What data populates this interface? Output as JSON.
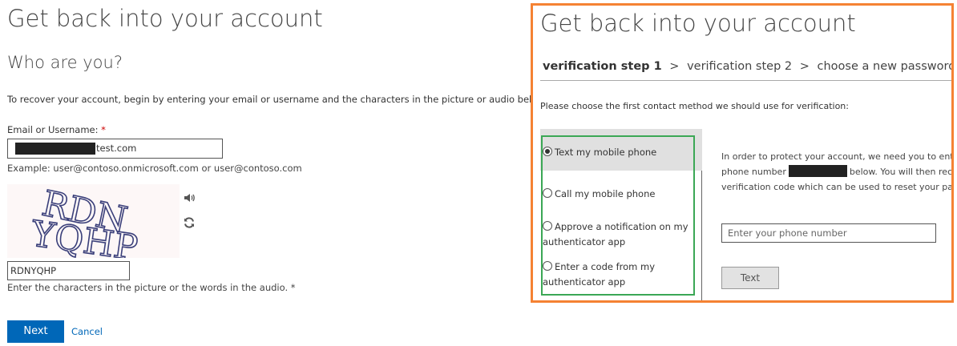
{
  "left": {
    "title": "Get back into your account",
    "subtitle": "Who are you?",
    "intro": "To recover your account, begin by entering your email or username and the characters in the picture or audio below.",
    "email_label": "Email or Username:",
    "required_mark": "*",
    "email_value_visible": "test.com",
    "email_example": "Example: user@contoso.onmicrosoft.com or user@contoso.com",
    "captcha_image_text": "RDNYQHP",
    "captcha_value": "RDNYQHP",
    "captcha_help": "Enter the characters in the picture or the words in the audio. *",
    "next_label": "Next",
    "cancel_label": "Cancel",
    "icons": {
      "audio": "speaker-icon",
      "refresh": "refresh-icon"
    }
  },
  "right": {
    "title": "Get back into your account",
    "steps": {
      "step1": "verification step 1",
      "step2": "verification step 2",
      "step3": "choose a new password",
      "separator": ">"
    },
    "prompt": "Please choose the first contact method we should use for verification:",
    "methods": [
      {
        "lines": [
          "Text my mobile phone"
        ],
        "selected": true
      },
      {
        "lines": [
          "Call my mobile phone"
        ],
        "selected": false
      },
      {
        "lines": [
          "Approve a notification on my",
          "authenticator app"
        ],
        "selected": false
      },
      {
        "lines": [
          "Enter a code from my",
          "authenticator app"
        ],
        "selected": false
      }
    ],
    "info_line1": "In order to protect your account, we need you to ente",
    "info_line2_pre": "phone number",
    "info_line2_post": "below. You will then rec",
    "info_line3": "verification code which can be used to reset your pas",
    "phone_placeholder": "Enter your phone number",
    "text_button_label": "Text"
  },
  "colors": {
    "accent_blue": "#0067b8",
    "highlight_orange": "#f58233",
    "highlight_green": "#3ba755",
    "required_red": "#cc0000"
  }
}
